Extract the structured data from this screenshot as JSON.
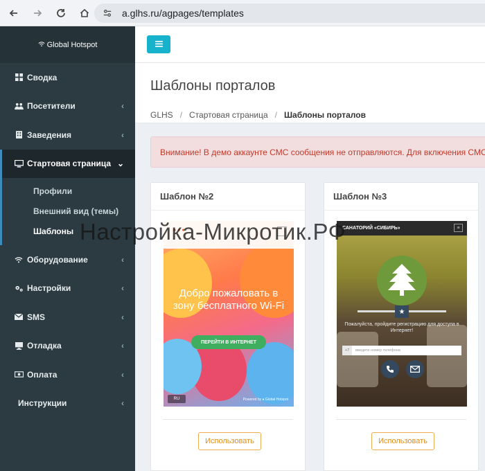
{
  "browser": {
    "url": "a.glhs.ru/agpages/templates"
  },
  "sidebar": {
    "brand": "Global Hotspot",
    "items": [
      {
        "label": "Сводка"
      },
      {
        "label": "Посетители"
      },
      {
        "label": "Заведения"
      },
      {
        "label": "Стартовая страница"
      },
      {
        "label": "Оборудование"
      },
      {
        "label": "Настройки"
      },
      {
        "label": "SMS"
      },
      {
        "label": "Отладка"
      },
      {
        "label": "Оплата"
      },
      {
        "label": "Инструкции"
      }
    ],
    "submenu": [
      {
        "label": "Профили"
      },
      {
        "label": "Внешний вид (темы)"
      },
      {
        "label": "Шаблоны"
      }
    ]
  },
  "header": {
    "title": "Шаблоны порталов",
    "breadcrumb": [
      "GLHS",
      "Стартовая страница",
      "Шаблоны порталов"
    ]
  },
  "alert": {
    "text": "Внимание! В демо аккаунте СМС сообщения не отправляются. Для включения СМС"
  },
  "cards": [
    {
      "title": "Шаблон №2",
      "button": "Использовать",
      "preview": {
        "welcome": "Добро пожаловать в зону бесплатного Wi-Fi",
        "cta": "ПЕРЕЙТИ В ИНТЕРНЕТ",
        "lang": "RU",
        "powered": "Powered by ● Global Hotspot"
      }
    },
    {
      "title": "Шаблон №3",
      "button": "Использовать",
      "preview": {
        "header": "САНАТОРИЙ «СИБИРЬ»",
        "text": "Пожалуйста, пройдите регистрацию для доступа в Интернет!",
        "code": "+7",
        "placeholder": "введите номер телефона"
      }
    }
  ],
  "watermark": "Настройка-Микротик.РФ",
  "colors": {
    "sidebar_bg": "#2c3b41",
    "accent": "#3c8dbc",
    "toggle": "#17b3cd",
    "alert_bg": "#f2dede",
    "alert_text": "#c0392b",
    "use_button": "#f0ad4e"
  }
}
